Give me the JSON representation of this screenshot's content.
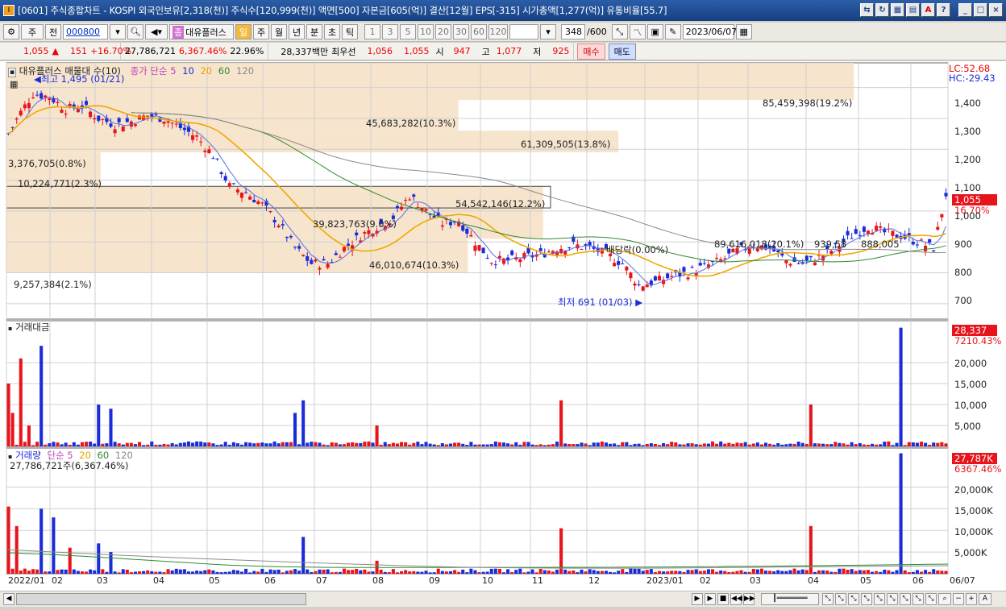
{
  "window": {
    "title": "[0601] 주식종합차트 - KOSPI 외국인보유[2,318(천)] 주식수[120,999(천)] 액면[500] 자본금[605(억)] 결산[12월] EPS[-315] 시가총액[1,277(억)] 유통비율[55.7]"
  },
  "toolbar": {
    "mode": "주",
    "market": "전",
    "code": "000800",
    "stock_name": "대유플러스",
    "periods": [
      "일",
      "주",
      "월",
      "년",
      "분",
      "초",
      "틱"
    ],
    "active_period": "일",
    "intervals": [
      "1",
      "3",
      "5",
      "10",
      "20",
      "30",
      "60",
      "120"
    ],
    "count": "348",
    "count_total": "/600",
    "date": "2023/06/07"
  },
  "quote": {
    "price": "1,055",
    "arrow": "▲",
    "change": "151",
    "change_pct": "+16.70%",
    "volume": "27,786,721",
    "volume_pct": "6,367.46%",
    "turnover": "22.96%",
    "value": "28,337백만",
    "best_label": "최우선",
    "ask": "1,056",
    "bid": "1,055",
    "open_label": "시",
    "open": "947",
    "high_label": "고",
    "high": "1,077",
    "low_label": "저",
    "low": "925",
    "buy": "매수",
    "sell": "매도"
  },
  "price_panel": {
    "legend_name": "대유플러스 매물대 수(10)",
    "legend_ma": "종가 단순 5",
    "legend_ma_periods": [
      "10",
      "20",
      "60",
      "120"
    ],
    "lc": "LC:52.68",
    "hc": "HC:-29.43",
    "high_marker": "최고 1,495 (01/21)",
    "low_marker": "최저 691 (01/03)",
    "current_price": "1,055",
    "current_pct": "16.70%",
    "y_ticks": [
      "1,400",
      "1,300",
      "1,200",
      "1,100",
      "1,000",
      "900",
      "800",
      "700"
    ],
    "profile_labels": [
      "85,459,398(19.2%)",
      "45,683,282(10.3%)",
      "61,309,505(13.8%)",
      "3,376,705(0.8%)",
      "10,224,771(2.3%)",
      "54,542,146(12.2%)",
      "39,823,763(9.0%)",
      "89,616,018(20.1%)",
      "46,010,674(10.3%)",
      "9,257,384(2.1%)",
      "배당락(0.00%)",
      "939,58",
      "888,005"
    ]
  },
  "value_panel": {
    "legend": "거래대금",
    "current": "28,337",
    "current_pct": "7210.43%",
    "y_ticks": [
      "20,000",
      "15,000",
      "10,000",
      "5,000"
    ]
  },
  "volume_panel": {
    "legend_name": "거래량",
    "legend_ma": "단순 5",
    "legend_ma_periods": [
      "20",
      "60",
      "120"
    ],
    "sub_legend": "27,786,721주(6,367.46%)",
    "current": "27,787K",
    "current_pct": "6367.46%",
    "y_ticks": [
      "20,000K",
      "15,000K",
      "10,000K",
      "5,000K"
    ]
  },
  "x_axis": [
    "2022/01",
    "02",
    "03",
    "04",
    "05",
    "06",
    "07",
    "08",
    "09",
    "10",
    "11",
    "12",
    "2023/01",
    "02",
    "03",
    "04",
    "05",
    "06",
    "06/07"
  ],
  "colors": {
    "up": "#e8141c",
    "down": "#1a2cd8",
    "ma5": "#5a6ee0",
    "ma20": "#f0a800",
    "ma60": "#2e8b2e",
    "ma120": "#8a8a8a",
    "profile": "#f5dfc4"
  },
  "chart_data": {
    "type": "candlestick",
    "x_start": "2022/01",
    "x_end": "2023/06/07",
    "ylim": [
      650,
      1480
    ],
    "close_path": [
      [
        0,
        1250
      ],
      [
        3,
        1320
      ],
      [
        6,
        1380
      ],
      [
        10,
        1370
      ],
      [
        14,
        1330
      ],
      [
        18,
        1340
      ],
      [
        22,
        1300
      ],
      [
        26,
        1280
      ],
      [
        30,
        1290
      ],
      [
        34,
        1310
      ],
      [
        38,
        1300
      ],
      [
        42,
        1270
      ],
      [
        46,
        1240
      ],
      [
        50,
        1180
      ],
      [
        54,
        1080
      ],
      [
        58,
        1060
      ],
      [
        62,
        1020
      ],
      [
        66,
        960
      ],
      [
        70,
        880
      ],
      [
        74,
        830
      ],
      [
        78,
        830
      ],
      [
        82,
        880
      ],
      [
        86,
        920
      ],
      [
        90,
        950
      ],
      [
        94,
        980
      ],
      [
        98,
        1050
      ],
      [
        102,
        1000
      ],
      [
        106,
        960
      ],
      [
        110,
        970
      ],
      [
        114,
        900
      ],
      [
        118,
        840
      ],
      [
        122,
        840
      ],
      [
        126,
        850
      ],
      [
        130,
        860
      ],
      [
        134,
        880
      ],
      [
        138,
        890
      ],
      [
        142,
        880
      ],
      [
        146,
        860
      ],
      [
        150,
        830
      ],
      [
        154,
        760
      ],
      [
        158,
        770
      ],
      [
        162,
        790
      ],
      [
        166,
        800
      ],
      [
        170,
        820
      ],
      [
        174,
        840
      ],
      [
        178,
        870
      ],
      [
        182,
        890
      ],
      [
        186,
        880
      ],
      [
        190,
        840
      ],
      [
        194,
        830
      ],
      [
        198,
        850
      ],
      [
        202,
        880
      ],
      [
        206,
        920
      ],
      [
        210,
        950
      ],
      [
        214,
        930
      ],
      [
        218,
        920
      ],
      [
        222,
        900
      ],
      [
        226,
        880
      ],
      [
        229,
        1055
      ]
    ],
    "value_millions": [
      [
        0,
        15000
      ],
      [
        1,
        8000
      ],
      [
        3,
        21000
      ],
      [
        5,
        5000
      ],
      [
        8,
        24000
      ],
      [
        22,
        10000
      ],
      [
        25,
        9000
      ],
      [
        70,
        8000
      ],
      [
        72,
        11000
      ],
      [
        90,
        5000
      ],
      [
        135,
        11000
      ],
      [
        196,
        10000
      ],
      [
        218,
        28337
      ]
    ],
    "volume_k": [
      [
        0,
        15500
      ],
      [
        2,
        11000
      ],
      [
        8,
        15000
      ],
      [
        11,
        13000
      ],
      [
        15,
        6000
      ],
      [
        22,
        7000
      ],
      [
        25,
        5000
      ],
      [
        72,
        8500
      ],
      [
        90,
        3000
      ],
      [
        135,
        10500
      ],
      [
        196,
        11000
      ],
      [
        218,
        27787
      ]
    ],
    "ma_periods": [
      5,
      10,
      20,
      60,
      120
    ]
  }
}
